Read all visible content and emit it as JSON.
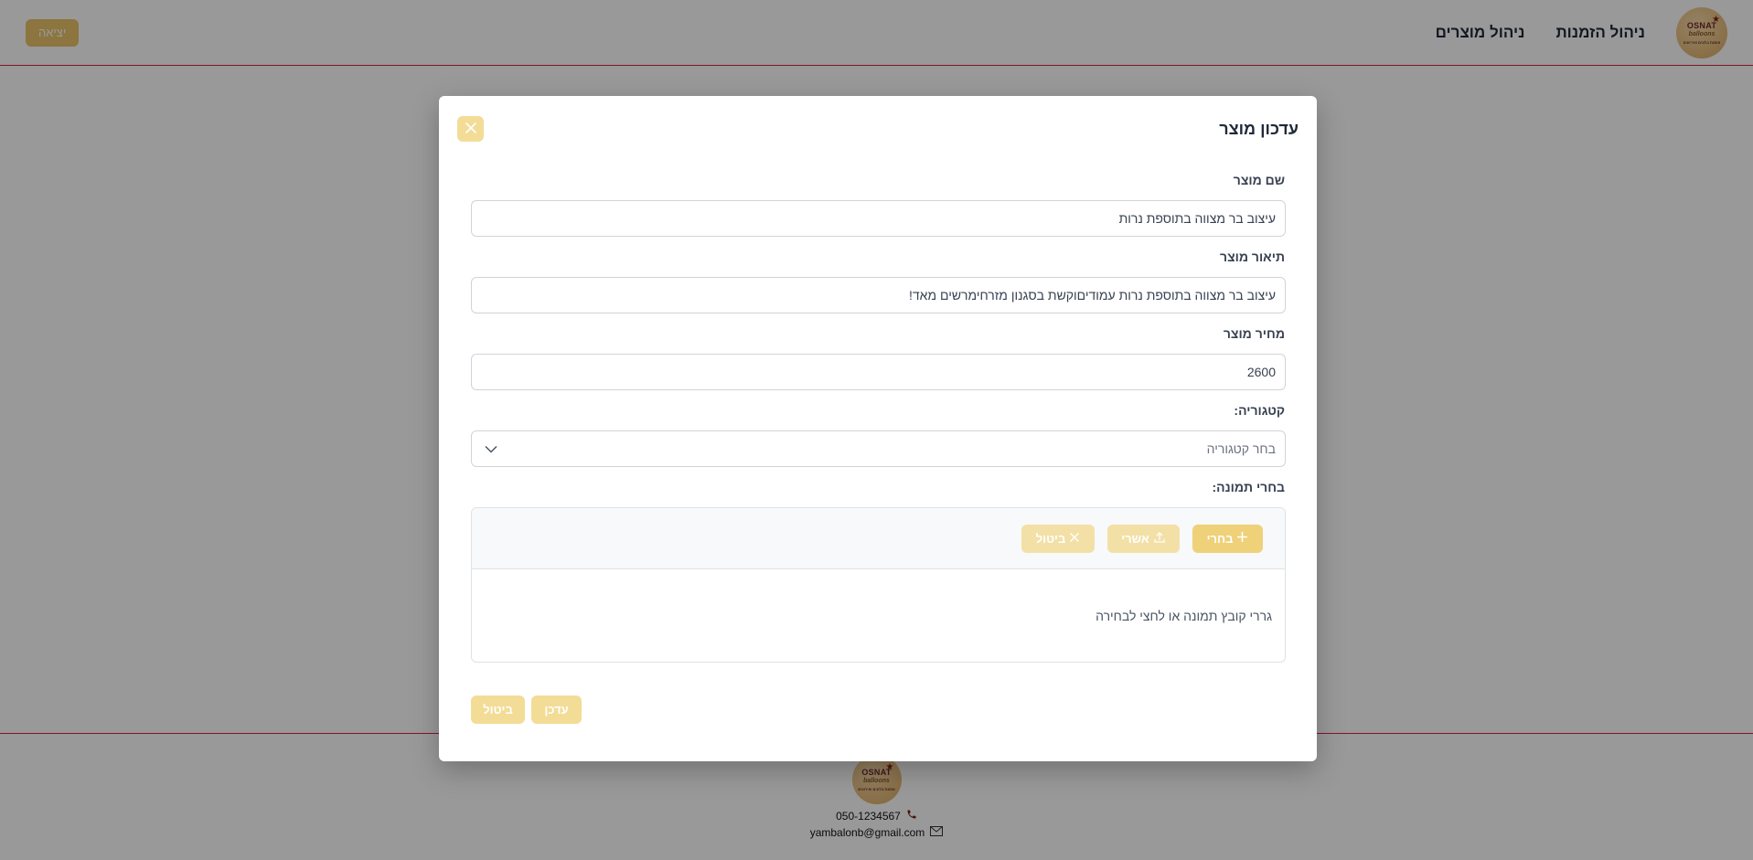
{
  "header": {
    "logo": {
      "line1": "OSNAT",
      "line2": "balloons",
      "line3": "אוסנת בלונים ואירועים"
    },
    "nav": [
      {
        "label": "ניהול הזמנות"
      },
      {
        "label": "ניהול מוצרים"
      }
    ],
    "logout_label": "יציאה"
  },
  "footer": {
    "phone": "050-1234567",
    "email": "yambalonb@gmail.com",
    "phone_icon": "phone-icon",
    "email_icon": "envelope-icon"
  },
  "modal": {
    "title": "עדכון מוצר",
    "close_icon": "close-icon",
    "fields": {
      "name": {
        "label": "שם מוצר",
        "value": "עיצוב בר מצווה בתוספת נרות"
      },
      "description": {
        "label": "תיאור מוצר",
        "value": "עיצוב בר מצווה בתוספת נרות עמודיםוקשת בסגנון מזרחימרשים מאד!"
      },
      "price": {
        "label": "מחיר מוצר",
        "value": "2600"
      },
      "category": {
        "label": "קטגוריה:",
        "selected": "בחר קטגוריה"
      },
      "image": {
        "label": "בחרי תמונה:"
      }
    },
    "upload": {
      "choose_label": "בחרי",
      "upload_label": "אשרי",
      "cancel_label": "ביטול",
      "drop_text": "גררי קובץ תמונה או לחצי לבחירה"
    },
    "actions": {
      "update_label": "עדכן",
      "cancel_label": "ביטול"
    },
    "colors": {
      "accent": "#e9c46a",
      "accent_light": "#f3dc96",
      "divider": "#e11d48"
    }
  }
}
